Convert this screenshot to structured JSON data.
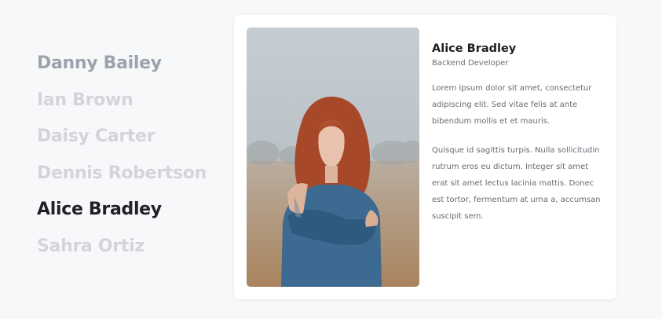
{
  "people": [
    {
      "name": "Danny Bailey"
    },
    {
      "name": "Ian Brown"
    },
    {
      "name": "Daisy Carter"
    },
    {
      "name": "Dennis Robertson"
    },
    {
      "name": "Alice Bradley"
    },
    {
      "name": "Sahra Ortiz"
    }
  ],
  "profile": {
    "name": "Alice Bradley",
    "role": "Backend Developer",
    "paragraphs": [
      "Lorem ipsum dolor sit amet, consectetur adipiscing elit. Sed vitae felis at ante bibendum mollis et et mauris.",
      "Quisque id sagittis turpis. Nulla sollicitudin rutrum eros eu dictum. Integer sit amet erat sit amet lectus lacinia mattis. Donec est tortor, fermentum at urna a, accumsan suscipit sem."
    ]
  },
  "colors": {
    "active": "#1f2127",
    "muted": "#9ea2ad",
    "inactive": "#d3d5da"
  }
}
